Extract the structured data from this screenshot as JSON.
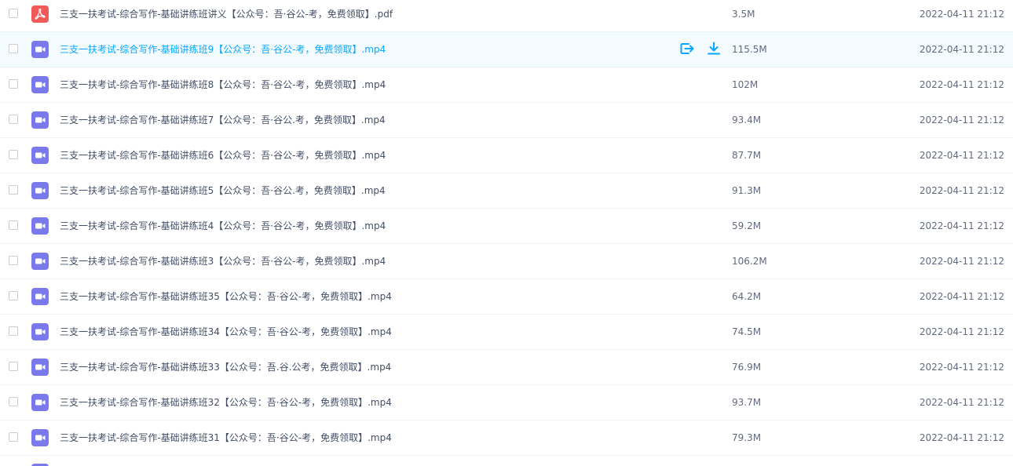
{
  "colors": {
    "pdf_icon": "#f25a59",
    "video_icon": "#7a79ec",
    "accent": "#06a7ff",
    "hover_bg": "#f4fbff",
    "text": "#424e67",
    "meta_text": "#616a7e"
  },
  "icons": {
    "pdf": "pdf-file-icon",
    "video": "video-file-icon",
    "share": "share-icon",
    "download": "download-icon"
  },
  "files": [
    {
      "name": "三支一扶考试-综合写作-基础讲练班讲义【公众号：吾·谷公-考，免费领取】.pdf",
      "type": "pdf",
      "size": "3.5M",
      "date": "2022-04-11 21:12"
    },
    {
      "name": "三支一扶考试-综合写作-基础讲练班9【公众号：吾·谷公-考，免费领取】.mp4",
      "type": "video",
      "size": "115.5M",
      "date": "2022-04-11 21:12",
      "hover": true
    },
    {
      "name": "三支一扶考试-综合写作-基础讲练班8【公众号：吾·谷公-考，免费领取】.mp4",
      "type": "video",
      "size": "102M",
      "date": "2022-04-11 21:12"
    },
    {
      "name": "三支一扶考试-综合写作-基础讲练班7【公众号：吾·谷公.考，免费领取】.mp4",
      "type": "video",
      "size": "93.4M",
      "date": "2022-04-11 21:12"
    },
    {
      "name": "三支一扶考试-综合写作-基础讲练班6【公众号：吾·谷公-考，免费领取】.mp4",
      "type": "video",
      "size": "87.7M",
      "date": "2022-04-11 21:12"
    },
    {
      "name": "三支一扶考试-综合写作-基础讲练班5【公众号：吾·谷公.考，免费领取】.mp4",
      "type": "video",
      "size": "91.3M",
      "date": "2022-04-11 21:12"
    },
    {
      "name": "三支一扶考试-综合写作-基础讲练班4【公众号：吾·谷公-考，免费领取】.mp4",
      "type": "video",
      "size": "59.2M",
      "date": "2022-04-11 21:12"
    },
    {
      "name": "三支一扶考试-综合写作-基础讲练班3【公众号：吾·谷公-考，免费领取】.mp4",
      "type": "video",
      "size": "106.2M",
      "date": "2022-04-11 21:12"
    },
    {
      "name": "三支一扶考试-综合写作-基础讲练班35【公众号：吾·谷公-考，免费领取】.mp4",
      "type": "video",
      "size": "64.2M",
      "date": "2022-04-11 21:12"
    },
    {
      "name": "三支一扶考试-综合写作-基础讲练班34【公众号：吾·谷公-考，免费领取】.mp4",
      "type": "video",
      "size": "74.5M",
      "date": "2022-04-11 21:12"
    },
    {
      "name": "三支一扶考试-综合写作-基础讲练班33【公众号：吾.谷.公考，免费领取】.mp4",
      "type": "video",
      "size": "76.9M",
      "date": "2022-04-11 21:12"
    },
    {
      "name": "三支一扶考试-综合写作-基础讲练班32【公众号：吾·谷公-考，免费领取】.mp4",
      "type": "video",
      "size": "93.7M",
      "date": "2022-04-11 21:12"
    },
    {
      "name": "三支一扶考试-综合写作-基础讲练班31【公众号：吾·谷公-考，免费领取】.mp4",
      "type": "video",
      "size": "79.3M",
      "date": "2022-04-11 21:12"
    }
  ]
}
